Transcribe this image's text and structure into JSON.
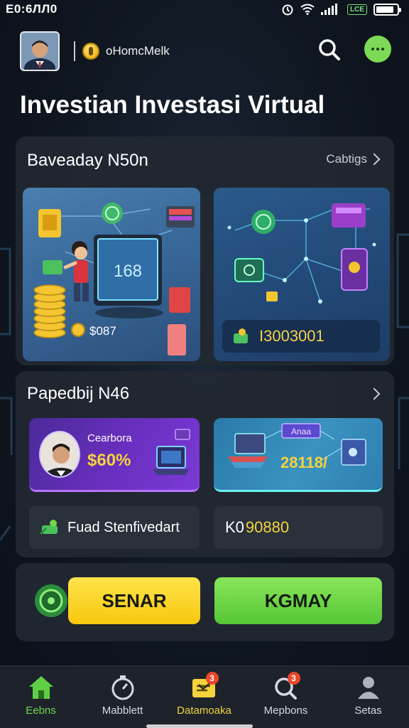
{
  "status_bar": {
    "time": "E0:6ЛЛ0",
    "network_badge": "LCE",
    "battery_level": 0.85
  },
  "header": {
    "username": "oHomcMelk",
    "icons": [
      "avatar",
      "coin-icon",
      "search-icon",
      "more-icon"
    ]
  },
  "page_title": "Investian Investasi Virtual",
  "section1": {
    "title": "Baveaday N50n",
    "link_label": "Cabtigs",
    "card_left": {
      "main_value": "168",
      "coin_value": "$087"
    },
    "card_right": {
      "value": "I3003001"
    }
  },
  "section2": {
    "title": "Papedbij N46",
    "promo_left": {
      "label": "Cearbora",
      "percent": "$60%"
    },
    "promo_right": {
      "tag": "Anaa",
      "value": "28118/"
    },
    "info_left": {
      "label": "Fuad Stenfivedart"
    },
    "info_right": {
      "prefix": "K0",
      "value": "90880"
    }
  },
  "actions": {
    "left_button": "SENAR",
    "right_button": "KGMAY",
    "colors": {
      "yellow": "#f7c80f",
      "green": "#55c636"
    }
  },
  "bottom_nav": {
    "items": [
      {
        "label": "Eebns",
        "icon": "home-icon",
        "badge": ""
      },
      {
        "label": "Mabblett",
        "icon": "timer-icon",
        "badge": ""
      },
      {
        "label": "Datamoaka",
        "icon": "ticket-icon",
        "badge": "3"
      },
      {
        "label": "Mepbons",
        "icon": "search-icon",
        "badge": "3"
      },
      {
        "label": "Setas",
        "icon": "user-icon",
        "badge": ""
      }
    ]
  }
}
